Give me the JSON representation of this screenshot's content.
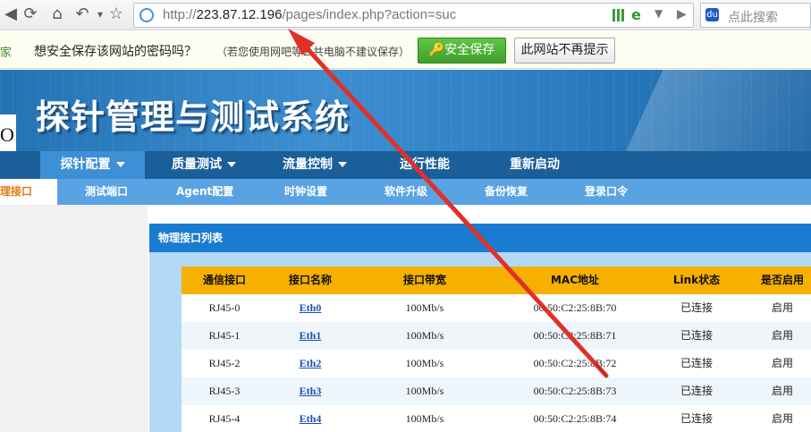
{
  "browser": {
    "url_prefix": "http://",
    "url_host": "223.87.12.196",
    "url_path": "/pages/index.php?action=suc",
    "search_placeholder": "点此搜索"
  },
  "password_bar": {
    "left_text": "家",
    "question": "想安全保存该网站的密码吗？",
    "note": "（若您使用网吧等公共电脑不建议保存）",
    "save_button": "安全保存",
    "never_button": "此网站不再提示"
  },
  "banner": {
    "title": "探针管理与测试系统",
    "left_letter": "O"
  },
  "main_nav": [
    {
      "label": "探针配置",
      "dropdown": true
    },
    {
      "label": "质量测试",
      "dropdown": true
    },
    {
      "label": "流量控制",
      "dropdown": true
    },
    {
      "label": "运行性能",
      "dropdown": false
    },
    {
      "label": "重新启动",
      "dropdown": false
    }
  ],
  "sub_nav": [
    {
      "label": "理接口"
    },
    {
      "label": "测试端口"
    },
    {
      "label": "Agent配置"
    },
    {
      "label": "时钟设置"
    },
    {
      "label": "软件升级"
    },
    {
      "label": "备份恢复"
    },
    {
      "label": "登录口令"
    }
  ],
  "panel": {
    "title": "物理接口列表",
    "headers": [
      "通信接口",
      "接口名称",
      "接口带宽",
      "MAC地址",
      "Link状态",
      "是否启用"
    ],
    "rows": [
      [
        "RJ45-0",
        "Eth0",
        "100Mb/s",
        "00:50:C2:25:8B:70",
        "已连接",
        "启用"
      ],
      [
        "RJ45-1",
        "Eth1",
        "100Mb/s",
        "00:50:C2:25:8B:71",
        "已连接",
        "启用"
      ],
      [
        "RJ45-2",
        "Eth2",
        "100Mb/s",
        "00:50:C2:25:8B:72",
        "已连接",
        "启用"
      ],
      [
        "RJ45-3",
        "Eth3",
        "100Mb/s",
        "00:50:C2:25:8B:73",
        "已连接",
        "启用"
      ],
      [
        "RJ45-4",
        "Eth4",
        "100Mb/s",
        "00:50:C2:25:8B:74",
        "已连接",
        "启用"
      ]
    ]
  },
  "colors": {
    "nav_bg": "#1a5e9a",
    "subnav_bg": "#5aa3e3",
    "table_header": "#f5b000",
    "annotation_arrow": "#e0302a"
  }
}
